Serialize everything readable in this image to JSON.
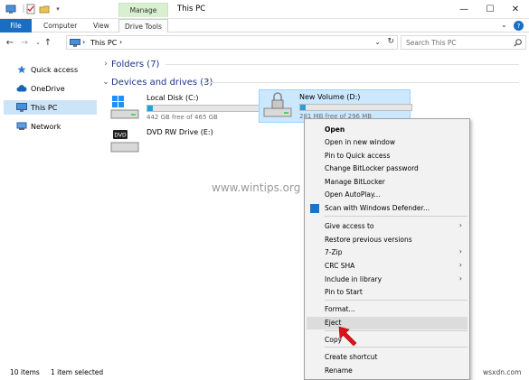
{
  "window": {
    "title": "This PC",
    "manage_tab": "Manage",
    "minimize": "—",
    "maximize": "☐",
    "close": "✕"
  },
  "ribbon": {
    "file": "File",
    "tabs": [
      "Computer",
      "View",
      "Drive Tools"
    ]
  },
  "address": {
    "path_label": "This PC",
    "search_placeholder": "Search This PC"
  },
  "nav_pane": {
    "items": [
      {
        "label": "Quick access",
        "icon": "star-icon"
      },
      {
        "label": "OneDrive",
        "icon": "cloud-icon"
      },
      {
        "label": "This PC",
        "icon": "computer-icon",
        "selected": true
      },
      {
        "label": "Network",
        "icon": "network-icon"
      }
    ]
  },
  "content": {
    "folders_group": "Folders (7)",
    "drives_group": "Devices and drives (3)",
    "drives": [
      {
        "name": "Local Disk (C:)",
        "free": "442 GB free of 465 GB",
        "used_fraction": 0.05
      },
      {
        "name": "New Volume (D:)",
        "free": "281 MB free of 296 MB",
        "used_fraction": 0.05,
        "selected": true
      },
      {
        "name": "DVD RW Drive (E:)",
        "free": ""
      }
    ]
  },
  "context_menu": {
    "items": [
      {
        "label": "Open",
        "bold": true
      },
      {
        "label": "Open in new window"
      },
      {
        "label": "Pin to Quick access"
      },
      {
        "label": "Change BitLocker password"
      },
      {
        "label": "Manage BitLocker"
      },
      {
        "label": "Open AutoPlay..."
      },
      {
        "label": "Scan with Windows Defender...",
        "icon": "windows-defender-icon"
      },
      {
        "label": "Give access to",
        "submenu": true
      },
      {
        "label": "Restore previous versions"
      },
      {
        "label": "7-Zip",
        "submenu": true
      },
      {
        "label": "CRC SHA",
        "submenu": true
      },
      {
        "label": "Include in library",
        "submenu": true
      },
      {
        "label": "Pin to Start"
      },
      {
        "label": "Format..."
      },
      {
        "label": "Eject",
        "highlighted": true
      },
      {
        "label": "Copy"
      },
      {
        "label": "Create shortcut"
      },
      {
        "label": "Rename"
      }
    ]
  },
  "status_bar": {
    "item_count": "10 items",
    "selection": "1 item selected"
  },
  "watermark": "www.wintips.org",
  "corner_mark": "wsxdn.com",
  "colors": {
    "accent": "#1a6ec2",
    "selection": "#cce8ff",
    "progress": "#26a0da",
    "arrow": "#d9141a"
  }
}
